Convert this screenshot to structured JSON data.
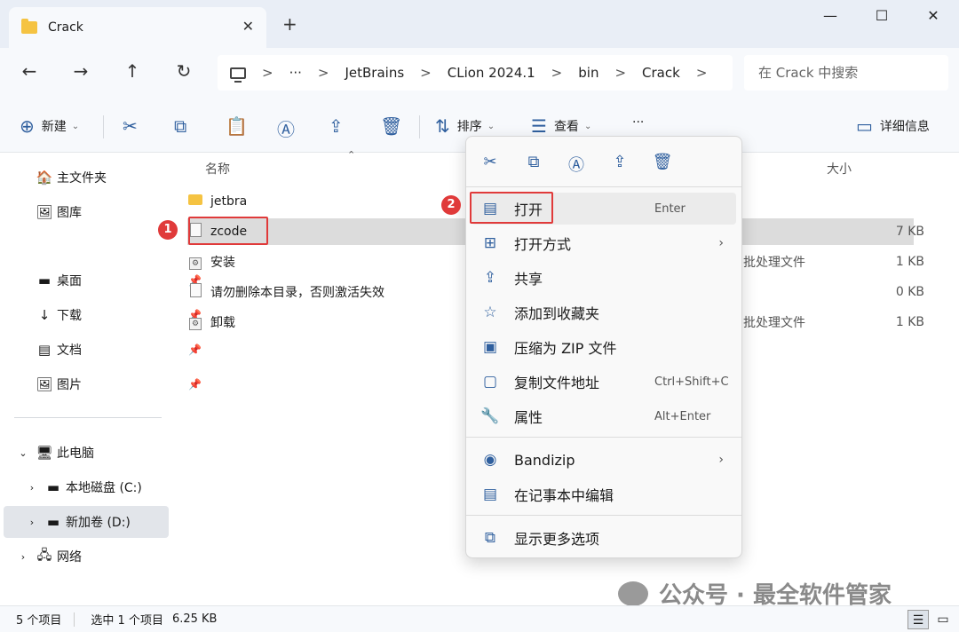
{
  "window": {
    "tab_title": "Crack",
    "tab_close": "✕",
    "new_tab": "+",
    "minimize": "—",
    "maximize": "☐",
    "close": "✕"
  },
  "nav": {
    "back": "←",
    "forward": "→",
    "up": "↑",
    "refresh": "↻"
  },
  "address": {
    "more": "···",
    "segments": [
      "JetBrains",
      "CLion 2024.1",
      "bin",
      "Crack"
    ],
    "separator": ">"
  },
  "search": {
    "placeholder": "在 Crack 中搜索"
  },
  "toolbar": {
    "new_label": "新建",
    "sort_label": "排序",
    "view_label": "查看",
    "more": "···",
    "details_label": "详细信息"
  },
  "sidebar": {
    "home": "主文件夹",
    "gallery": "图库",
    "desktop": "桌面",
    "downloads": "下载",
    "documents": "文档",
    "pictures": "图片",
    "this_pc": "此电脑",
    "local_disk": "本地磁盘 (C:)",
    "new_volume": "新加卷 (D:)",
    "network": "网络"
  },
  "filelist": {
    "col_name": "名称",
    "col_size": "大小",
    "rows": [
      {
        "name": "jetbra",
        "type": "",
        "size": ""
      },
      {
        "name": "zcode",
        "type": "",
        "size": "7 KB"
      },
      {
        "name": "安装",
        "type": "批处理文件",
        "size": "1 KB"
      },
      {
        "name": "请勿删除本目录，否则激活失效",
        "type": "",
        "size": "0 KB"
      },
      {
        "name": "卸载",
        "type": "批处理文件",
        "size": "1 KB"
      }
    ]
  },
  "annotations": {
    "badge1": "1",
    "badge2": "2",
    "color": "#e03a3a"
  },
  "context_menu": {
    "open": "打开",
    "open_shortcut": "Enter",
    "open_with": "打开方式",
    "share": "共享",
    "add_favorites": "添加到收藏夹",
    "compress_zip": "压缩为 ZIP 文件",
    "copy_path": "复制文件地址",
    "copy_path_shortcut": "Ctrl+Shift+C",
    "properties": "属性",
    "properties_shortcut": "Alt+Enter",
    "bandizip": "Bandizip",
    "edit_notepad": "在记事本中编辑",
    "more_options": "显示更多选项"
  },
  "status": {
    "count": "5 个项目",
    "selected": "选中 1 个项目",
    "size": "6.25 KB"
  },
  "watermark": {
    "text": "公众号 · 最全软件管家"
  },
  "colors": {
    "accent": "#2f5f9e",
    "titlebar": "#e9eef6",
    "selection": "#dcdcdc"
  }
}
